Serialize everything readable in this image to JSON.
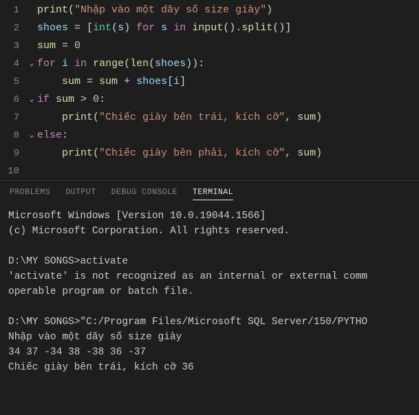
{
  "editor": {
    "lines": [
      {
        "num": "1",
        "fold": "",
        "tokens": [
          [
            "fn",
            "print"
          ],
          [
            "pun",
            "("
          ],
          [
            "str",
            "\"Nhập vào một dãy số size giày\""
          ],
          [
            "pun",
            ")"
          ]
        ]
      },
      {
        "num": "2",
        "fold": "",
        "tokens": [
          [
            "var",
            "shoes"
          ],
          [
            "op",
            " = "
          ],
          [
            "pun",
            "["
          ],
          [
            "tp",
            "int"
          ],
          [
            "pun",
            "("
          ],
          [
            "var",
            "s"
          ],
          [
            "pun",
            ")"
          ],
          [
            "op",
            " "
          ],
          [
            "kw",
            "for"
          ],
          [
            "op",
            " "
          ],
          [
            "var",
            "s"
          ],
          [
            "op",
            " "
          ],
          [
            "kw",
            "in"
          ],
          [
            "op",
            " "
          ],
          [
            "fn",
            "input"
          ],
          [
            "pun",
            "()"
          ],
          [
            "pun",
            "."
          ],
          [
            "fn",
            "split"
          ],
          [
            "pun",
            "()"
          ],
          [
            "pun",
            "]"
          ]
        ]
      },
      {
        "num": "3",
        "fold": "",
        "tokens": [
          [
            "fn",
            "sum"
          ],
          [
            "op",
            " = "
          ],
          [
            "num",
            "0"
          ]
        ]
      },
      {
        "num": "4",
        "fold": "⌄",
        "tokens": [
          [
            "kw",
            "for"
          ],
          [
            "op",
            " "
          ],
          [
            "var",
            "i"
          ],
          [
            "op",
            " "
          ],
          [
            "kw",
            "in"
          ],
          [
            "op",
            " "
          ],
          [
            "fn",
            "range"
          ],
          [
            "pun",
            "("
          ],
          [
            "fn",
            "len"
          ],
          [
            "pun",
            "("
          ],
          [
            "var",
            "shoes"
          ],
          [
            "pun",
            "))"
          ],
          [
            "pun",
            ":"
          ]
        ]
      },
      {
        "num": "5",
        "fold": "",
        "tokens": [
          [
            "op",
            "    "
          ],
          [
            "fn",
            "sum"
          ],
          [
            "op",
            " = "
          ],
          [
            "fn",
            "sum"
          ],
          [
            "op",
            " + "
          ],
          [
            "var",
            "shoes"
          ],
          [
            "pun",
            "["
          ],
          [
            "var",
            "i"
          ],
          [
            "pun",
            "]"
          ]
        ]
      },
      {
        "num": "6",
        "fold": "⌄",
        "tokens": [
          [
            "kw",
            "if"
          ],
          [
            "op",
            " "
          ],
          [
            "fn",
            "sum"
          ],
          [
            "op",
            " > "
          ],
          [
            "num",
            "0"
          ],
          [
            "pun",
            ":"
          ]
        ]
      },
      {
        "num": "7",
        "fold": "",
        "tokens": [
          [
            "op",
            "    "
          ],
          [
            "fn",
            "print"
          ],
          [
            "pun",
            "("
          ],
          [
            "str",
            "\"Chiếc giày bên trái, kích cỡ\""
          ],
          [
            "pun",
            ","
          ],
          [
            "op",
            " "
          ],
          [
            "fn",
            "sum"
          ],
          [
            "pun",
            ")"
          ]
        ]
      },
      {
        "num": "8",
        "fold": "⌄",
        "tokens": [
          [
            "kw",
            "else"
          ],
          [
            "pun",
            ":"
          ]
        ]
      },
      {
        "num": "9",
        "fold": "",
        "tokens": [
          [
            "op",
            "    "
          ],
          [
            "fn",
            "print"
          ],
          [
            "pun",
            "("
          ],
          [
            "str",
            "\"Chiếc giày bên phải, kích cỡ\""
          ],
          [
            "pun",
            ","
          ],
          [
            "op",
            " "
          ],
          [
            "fn",
            "sum"
          ],
          [
            "pun",
            ")"
          ]
        ]
      },
      {
        "num": "10",
        "fold": "",
        "tokens": []
      }
    ]
  },
  "panel": {
    "tabs": [
      "PROBLEMS",
      "OUTPUT",
      "DEBUG CONSOLE",
      "TERMINAL"
    ],
    "activeTab": 3,
    "terminal": [
      "Microsoft Windows [Version 10.0.19044.1566]",
      "(c) Microsoft Corporation. All rights reserved.",
      "",
      "D:\\MY SONGS>activate",
      "'activate' is not recognized as an internal or external comm",
      "operable program or batch file.",
      "",
      "D:\\MY SONGS>\"C:/Program Files/Microsoft SQL Server/150/PYTHO",
      "Nhập vào một dãy số size giày",
      "34 37 -34 38 -38 36 -37",
      "Chiếc giày bên trái, kích cỡ 36"
    ]
  }
}
